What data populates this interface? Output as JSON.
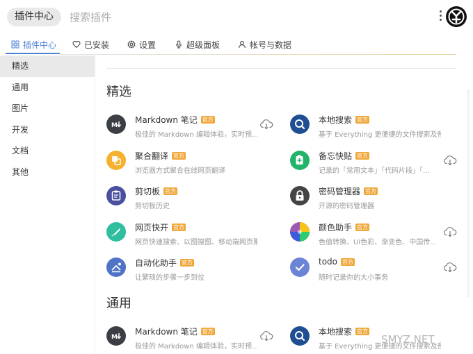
{
  "topbar": {
    "current_label": "插件中心",
    "search_placeholder": "搜索插件"
  },
  "tabs": [
    {
      "label": "插件中心",
      "icon": "grid-icon",
      "active": true
    },
    {
      "label": "已安装",
      "icon": "heart-icon",
      "active": false
    },
    {
      "label": "设置",
      "icon": "gear-icon",
      "active": false
    },
    {
      "label": "超级面板",
      "icon": "microphone-icon",
      "active": false
    },
    {
      "label": "帐号与数据",
      "icon": "user-icon",
      "active": false
    }
  ],
  "sidebar": {
    "items": [
      {
        "label": "精选",
        "active": true
      },
      {
        "label": "通用",
        "active": false
      },
      {
        "label": "图片",
        "active": false
      },
      {
        "label": "开发",
        "active": false
      },
      {
        "label": "文档",
        "active": false
      },
      {
        "label": "其他",
        "active": false
      }
    ]
  },
  "sections": [
    {
      "title": "精选",
      "plugins": [
        {
          "name": "Markdown 笔记",
          "badge": "官方",
          "desc": "极佳的 Markdown 编辑体验，实时预...",
          "icon": "markdown-icon",
          "color": "#3b3f45",
          "download": true
        },
        {
          "name": "本地搜索",
          "badge": "官方",
          "desc": "基于 Everything 更便捷的文件搜索及预览",
          "icon": "magnifier-icon",
          "color": "#1f4e93",
          "download": false
        },
        {
          "name": "聚合翻译",
          "badge": "官方",
          "desc": "浏览器方式聚合在线网页翻译",
          "icon": "translate-icon",
          "color": "#f5b12f",
          "download": false
        },
        {
          "name": "备忘快贴",
          "badge": "官方",
          "desc": "记录的「常用文本」「代码片段」「...",
          "icon": "clipboard-plus-icon",
          "color": "#23b36b",
          "download": true
        },
        {
          "name": "剪切板",
          "badge": "官方",
          "desc": "剪切板历史",
          "icon": "clipboard-icon",
          "color": "#4a4f9e",
          "download": false
        },
        {
          "name": "密码管理器",
          "badge": "官方",
          "desc": "开源的密码管理器",
          "icon": "lock-icon",
          "color": "#444444",
          "download": false
        },
        {
          "name": "网页快开",
          "badge": "官方",
          "desc": "网页快速搜索、以图搜图、移动端网页聚合",
          "icon": "rocket-icon",
          "color": "#2fbf9f",
          "download": false
        },
        {
          "name": "颜色助手",
          "badge": "官方",
          "desc": "色值转换、UI色彩、渐变色、中国传...",
          "icon": "color-wheel-icon",
          "color": "#e84d3c",
          "download": true
        },
        {
          "name": "自动化助手",
          "badge": "官方",
          "desc": "让繁琐的步骤一步到位",
          "icon": "automation-icon",
          "color": "#4f73c7",
          "download": false
        },
        {
          "name": "todo",
          "badge": "官方",
          "desc": "随时记录你的大小事务",
          "icon": "check-icon",
          "color": "#6b84d6",
          "download": true
        }
      ]
    },
    {
      "title": "通用",
      "plugins": [
        {
          "name": "Markdown 笔记",
          "badge": "官方",
          "desc": "极佳的 Markdown 编辑体验，实时预...",
          "icon": "markdown-icon",
          "color": "#3b3f45",
          "download": true
        },
        {
          "name": "本地搜索",
          "badge": "官方",
          "desc": "基于 Everything 更便捷的文件搜索及预览",
          "icon": "magnifier-icon",
          "color": "#1f4e93",
          "download": false
        }
      ]
    }
  ],
  "watermark": "SMYZ.NET"
}
